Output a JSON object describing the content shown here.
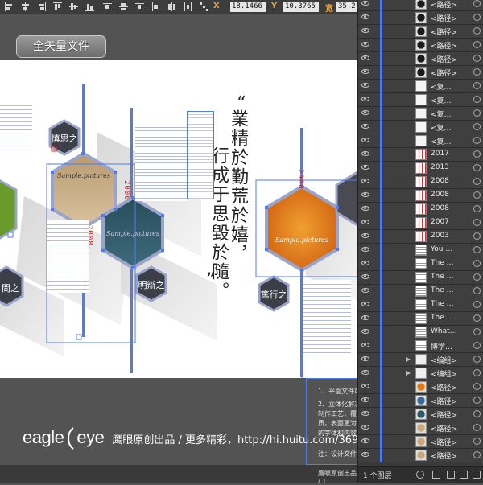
{
  "toolbar": {
    "x_label": "X",
    "x_value": "18.1466",
    "y_label": "Y",
    "y_value": "10.3765",
    "w_label": "宽",
    "w_value": "35.2"
  },
  "badge": {
    "label": "全矢量文件"
  },
  "artboard": {
    "quote_lines": [
      "業精於勤荒於嬉，",
      "行成于思毀於隨。"
    ],
    "quote_open": "“",
    "quote_close": "”",
    "hex_placeholder": "Sample.pictures",
    "hex_titles": [
      "慎思之",
      "明辯之",
      "篤行之",
      "問之"
    ],
    "years": [
      "2006",
      "2008",
      "2008"
    ]
  },
  "notes": {
    "lines": [
      "1、平面文件可…",
      "2、立体化解决方…",
      "制作工艺，覆盖…",
      "质，表面更为柔…",
      "的字体和内容…",
      "注：设计文件中…"
    ]
  },
  "status": {
    "text": "鷹眼原创出品 / 1"
  },
  "watermark": {
    "brand": "eagleeye",
    "brand_left": "eagle",
    "brand_right": "eye",
    "credit": "鹰眼原创出品 / 更多精彩，http://hi.huitu.com/369/"
  },
  "layers_panel": {
    "count_label": "1 个图层",
    "rows": [
      {
        "name": "<路径>",
        "thumb": "dark"
      },
      {
        "name": "<路径>",
        "thumb": "dark"
      },
      {
        "name": "<路径>",
        "thumb": "dark"
      },
      {
        "name": "<路径>",
        "thumb": "dark"
      },
      {
        "name": "<路径>",
        "thumb": "dark"
      },
      {
        "name": "<路径>",
        "thumb": "dark"
      },
      {
        "name": "<复…",
        "thumb": "light"
      },
      {
        "name": "<复…",
        "thumb": "light"
      },
      {
        "name": "<复…",
        "thumb": "light"
      },
      {
        "name": "<复…",
        "thumb": "light"
      },
      {
        "name": "<复…",
        "thumb": "light"
      },
      {
        "name": "2017",
        "thumb": "year"
      },
      {
        "name": "2013",
        "thumb": "year"
      },
      {
        "name": "2008",
        "thumb": "year"
      },
      {
        "name": "2008",
        "thumb": "year"
      },
      {
        "name": "2008",
        "thumb": "year"
      },
      {
        "name": "2007",
        "thumb": "year"
      },
      {
        "name": "2003",
        "thumb": "year"
      },
      {
        "name": "You …",
        "thumb": "text"
      },
      {
        "name": "The …",
        "thumb": "text"
      },
      {
        "name": "The …",
        "thumb": "text"
      },
      {
        "name": "The …",
        "thumb": "text"
      },
      {
        "name": "The …",
        "thumb": "text"
      },
      {
        "name": "The …",
        "thumb": "text"
      },
      {
        "name": "What…",
        "thumb": "text"
      },
      {
        "name": "博学…",
        "thumb": "text"
      },
      {
        "name": "<编组>",
        "thumb": "group",
        "expand": true
      },
      {
        "name": "<编组>",
        "thumb": "group",
        "expand": true
      },
      {
        "name": "<路径>",
        "thumb": "orange"
      },
      {
        "name": "<路径>",
        "thumb": "blue"
      },
      {
        "name": "<路径>",
        "thumb": "teal"
      },
      {
        "name": "<路径>",
        "thumb": "tan"
      },
      {
        "name": "<路径>",
        "thumb": "tan"
      },
      {
        "name": "<路径>",
        "thumb": "tan"
      },
      {
        "name": "<路径>",
        "thumb": "tan"
      }
    ]
  },
  "colors": {
    "hex_orange": "#e07a10",
    "hex_tan": "#c9a97c",
    "hex_teal": "#2f5a6a",
    "hex_green": "#6a9a2a",
    "hex_dark": "#3c3f48",
    "selection": "#4d7cf0",
    "year_red": "#cc2222"
  }
}
